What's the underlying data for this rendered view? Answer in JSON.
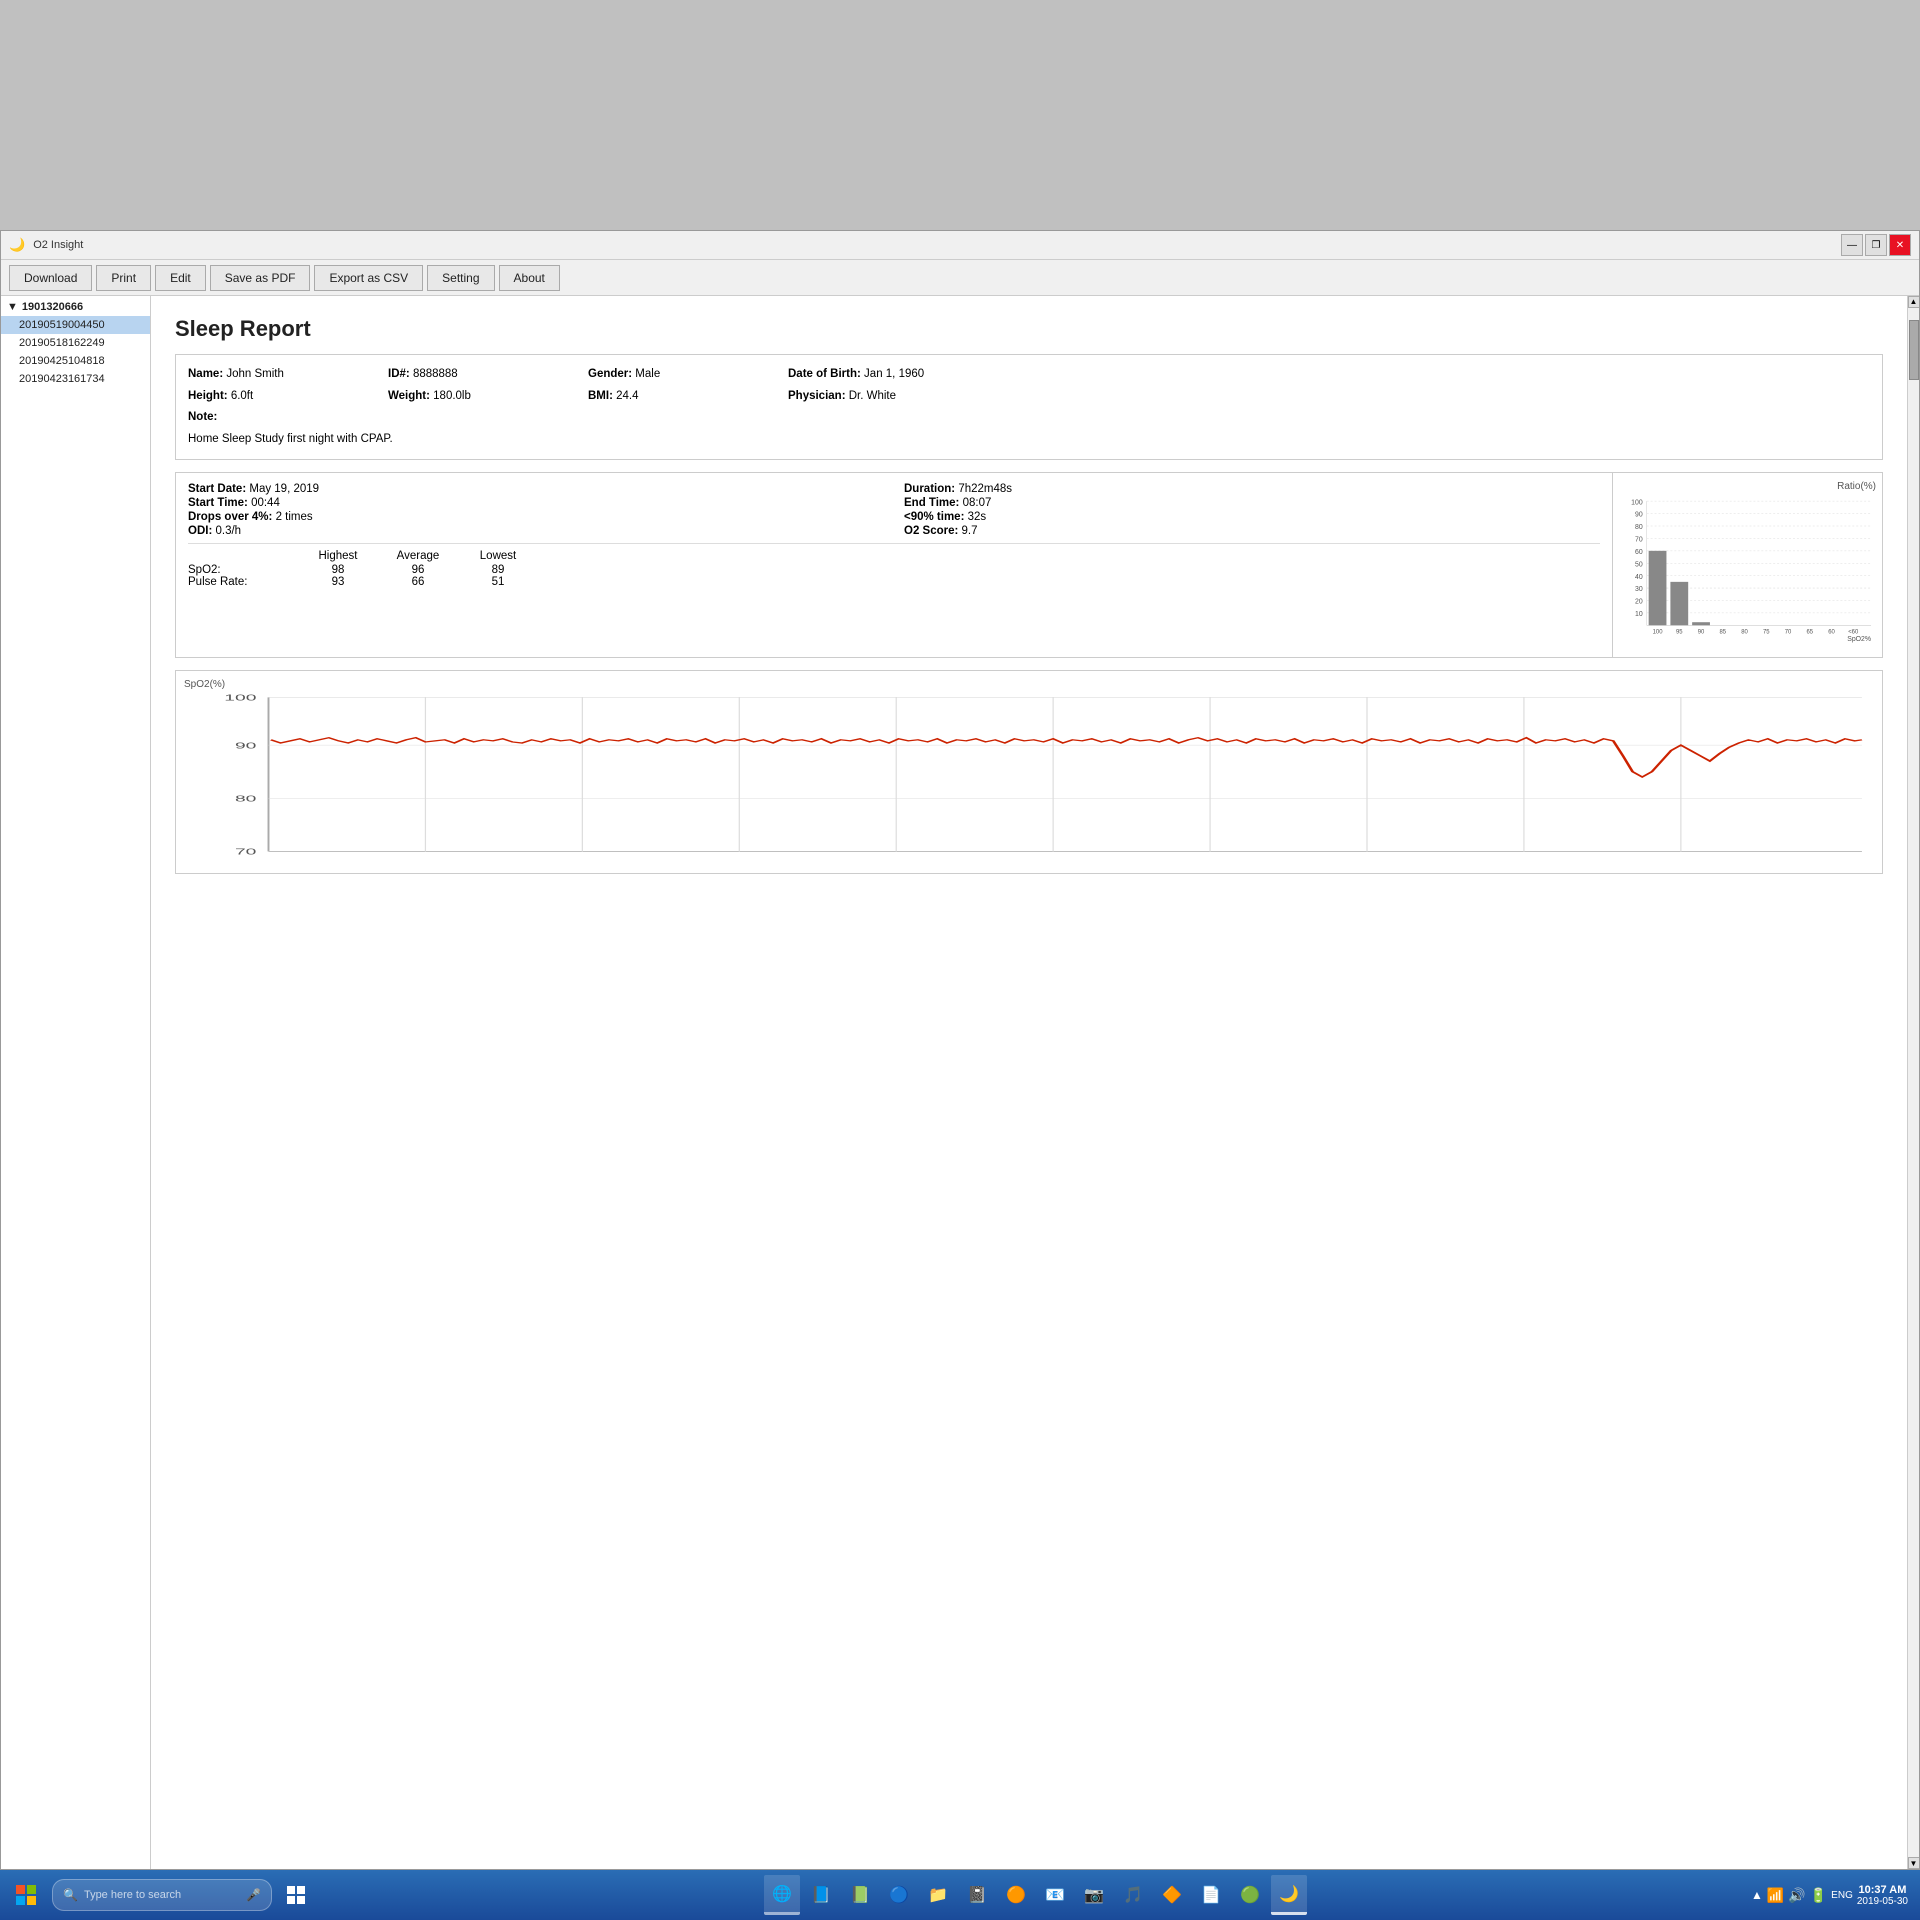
{
  "app": {
    "title": "O2 Insight",
    "window_controls": [
      "—",
      "❐",
      "✕"
    ]
  },
  "toolbar": {
    "buttons": [
      "Download",
      "Print",
      "Edit",
      "Save as PDF",
      "Export as CSV",
      "Setting",
      "About"
    ]
  },
  "sidebar": {
    "group": "1901320666",
    "items": [
      "20190519004450",
      "20190518162249",
      "20190425104818",
      "20190423161734"
    ]
  },
  "report": {
    "title": "Sleep Report",
    "patient": {
      "name_label": "Name:",
      "name_value": "John Smith",
      "id_label": "ID#:",
      "id_value": "8888888",
      "gender_label": "Gender:",
      "gender_value": "Male",
      "dob_label": "Date of Birth:",
      "dob_value": "Jan 1, 1960",
      "height_label": "Height:",
      "height_value": "6.0ft",
      "weight_label": "Weight:",
      "weight_value": "180.0lb",
      "bmi_label": "BMI:",
      "bmi_value": "24.4",
      "physician_label": "Physician:",
      "physician_value": "Dr. White",
      "note_label": "Note:",
      "note_value": "Home Sleep Study first night with CPAP."
    },
    "session": {
      "start_date_label": "Start Date:",
      "start_date_value": "May 19, 2019",
      "duration_label": "Duration:",
      "duration_value": "7h22m48s",
      "start_time_label": "Start Time:",
      "start_time_value": "00:44",
      "end_time_label": "End Time:",
      "end_time_value": "08:07",
      "drops_label": "Drops over 4%:",
      "drops_value": "2 times",
      "below90_label": "<90% time:",
      "below90_value": "32s",
      "odi_label": "ODI:",
      "odi_value": "0.3/h",
      "o2score_label": "O2 Score:",
      "o2score_value": "9.7"
    },
    "stats": {
      "headers": [
        "",
        "Highest",
        "Average",
        "Lowest"
      ],
      "rows": [
        {
          "label": "SpO2:",
          "highest": "98",
          "average": "96",
          "lowest": "89"
        },
        {
          "label": "Pulse Rate:",
          "highest": "93",
          "average": "66",
          "lowest": "51"
        }
      ]
    },
    "bar_chart": {
      "title": "Ratio(%)",
      "y_labels": [
        "100",
        "90",
        "80",
        "70",
        "60",
        "50",
        "40",
        "30",
        "20",
        "10"
      ],
      "x_labels": [
        "100",
        "95",
        "90",
        "85",
        "80",
        "75",
        "70",
        "65",
        "60",
        "<60"
      ],
      "x_suffix": "SpO2%",
      "bars": [
        {
          "x": "100",
          "height_pct": 60
        },
        {
          "x": "95",
          "height_pct": 35
        },
        {
          "x": "90",
          "height_pct": 2
        },
        {
          "x": "85",
          "height_pct": 0
        },
        {
          "x": "80",
          "height_pct": 0
        },
        {
          "x": "75",
          "height_pct": 0
        },
        {
          "x": "70",
          "height_pct": 0
        },
        {
          "x": "65",
          "height_pct": 0
        },
        {
          "x": "60",
          "height_pct": 0
        },
        {
          "x": "<60",
          "height_pct": 0
        }
      ]
    },
    "spo2_chart": {
      "title": "SpO2(%)",
      "y_labels": [
        "100",
        "90",
        "80",
        "70"
      ],
      "y_gridlines": [
        100,
        90,
        80,
        70
      ]
    }
  },
  "taskbar": {
    "search_placeholder": "Type here to search",
    "time": "10:37 AM",
    "date": "2019-05-30",
    "lang": "ENG"
  }
}
